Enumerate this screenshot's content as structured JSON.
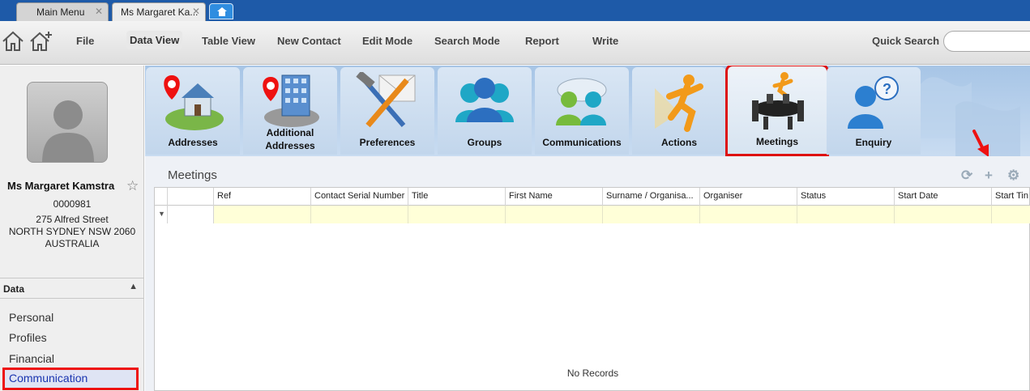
{
  "tabs": [
    {
      "label": "Main Menu"
    },
    {
      "label": "Ms Margaret Ka..."
    }
  ],
  "toolbar": {
    "items": [
      "File",
      "Data View",
      "Table View",
      "New Contact",
      "Edit Mode",
      "Search Mode",
      "Report",
      "Write"
    ],
    "active": "Data View",
    "quick_search_label": "Quick Search",
    "quick_search_value": ""
  },
  "contact": {
    "name": "Ms Margaret Kamstra",
    "serial": "0000981",
    "address_line1": "275 Alfred Street",
    "address_line2": "NORTH SYDNEY NSW 2060",
    "country": "AUSTRALIA"
  },
  "sidebar": {
    "section_title": "Data",
    "items": [
      {
        "label": "Personal"
      },
      {
        "label": "Profiles"
      },
      {
        "label": "Financial"
      },
      {
        "label": "Communication",
        "selected": true
      }
    ]
  },
  "modules": [
    {
      "label": "Addresses",
      "icon": "addresses-icon"
    },
    {
      "label": "Additional Addresses",
      "line1": "Additional",
      "line2": "Addresses",
      "icon": "additional-addresses-icon"
    },
    {
      "label": "Preferences",
      "icon": "preferences-icon"
    },
    {
      "label": "Groups",
      "icon": "groups-icon"
    },
    {
      "label": "Communications",
      "icon": "communications-icon"
    },
    {
      "label": "Actions",
      "icon": "actions-icon"
    },
    {
      "label": "Meetings",
      "icon": "meetings-icon",
      "selected": true
    },
    {
      "label": "Enquiry",
      "icon": "enquiry-icon"
    }
  ],
  "panel": {
    "title": "Meetings",
    "columns": [
      "Ref",
      "Contact Serial Number",
      "Title",
      "First Name",
      "Surname / Organisa...",
      "Organiser",
      "Status",
      "Start Date",
      "Start Tin"
    ],
    "rows": [],
    "empty_text": "No Records"
  },
  "colors": {
    "tab_strip": "#1e5aa8",
    "highlight": "#e11111",
    "filter_row": "#ffffd8",
    "selected_nav_text": "#1a35b0"
  }
}
